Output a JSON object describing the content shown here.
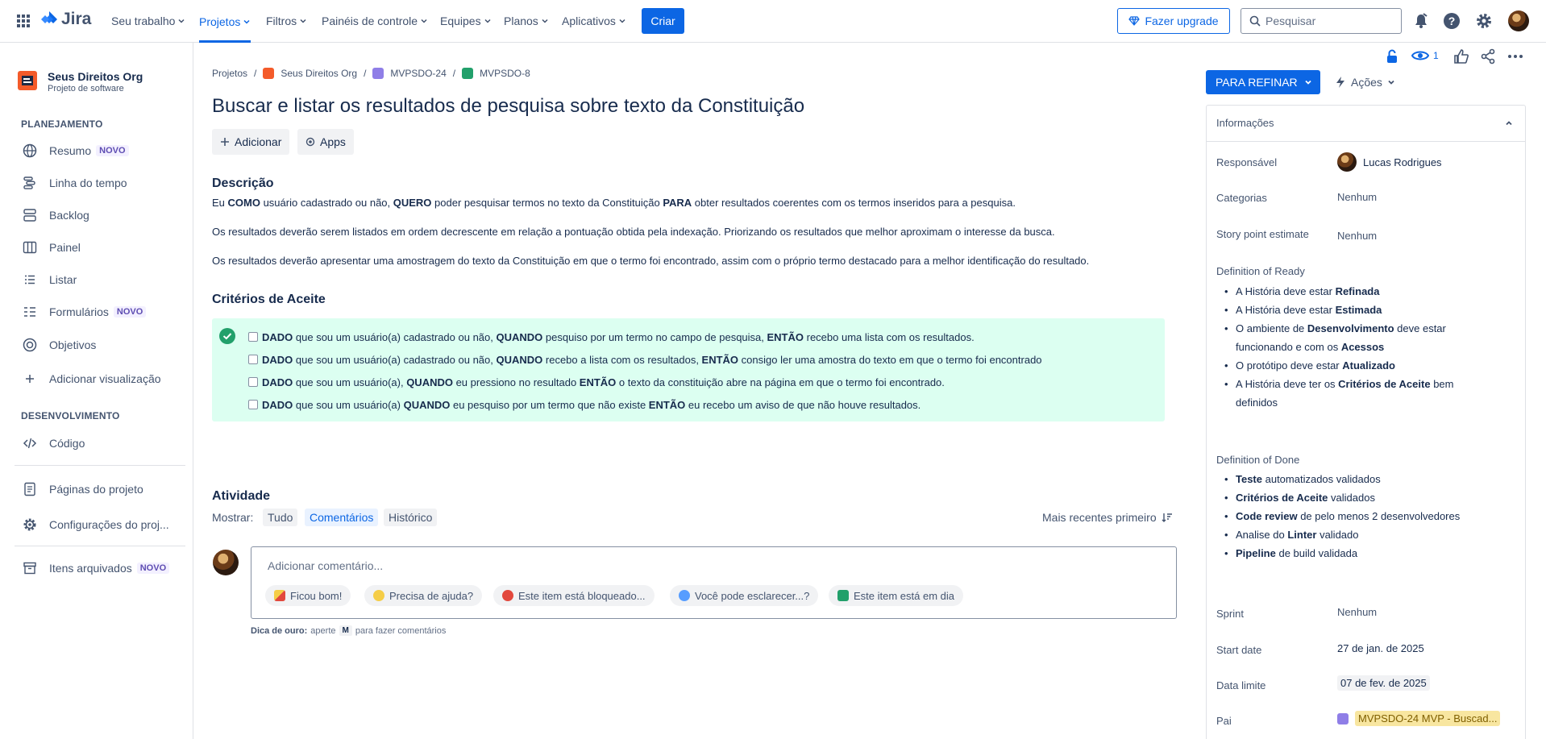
{
  "nav": {
    "logo": "Jira",
    "items": [
      "Seu trabalho",
      "Projetos",
      "Filtros",
      "Painéis de controle",
      "Equipes",
      "Planos",
      "Aplicativos"
    ],
    "create": "Criar",
    "upgrade": "Fazer upgrade",
    "search_placeholder": "Pesquisar"
  },
  "sidebar": {
    "project_name": "Seus Direitos Org",
    "project_type": "Projeto de software",
    "group_planning": "PLANEJAMENTO",
    "group_dev": "DESENVOLVIMENTO",
    "new_badge": "NOVO",
    "items": {
      "resumo": "Resumo",
      "linha": "Linha do tempo",
      "backlog": "Backlog",
      "painel": "Painel",
      "listar": "Listar",
      "formularios": "Formulários",
      "objetivos": "Objetivos",
      "adicionar": "Adicionar visualização",
      "codigo": "Código",
      "paginas": "Páginas do projeto",
      "config": "Configurações do proj...",
      "arquivados": "Itens arquivados"
    }
  },
  "issue": {
    "breadcrumbs": [
      "Projetos",
      "Seus Direitos Org",
      "MVPSDO-24",
      "MVPSDO-8"
    ],
    "title": "Buscar e listar os resultados de pesquisa sobre texto da Constituição",
    "add": "Adicionar",
    "apps": "Apps",
    "desc_heading": "Descrição",
    "desc": {
      "p1_a": "Eu ",
      "p1_b": "COMO",
      "p1_c": " usuário cadastrado ou não, ",
      "p1_d": "QUERO",
      "p1_e": " poder pesquisar termos no texto da Constituição ",
      "p1_f": "PARA",
      "p1_g": " obter resultados coerentes com os termos inseridos para a pesquisa.",
      "p2": "Os resultados deverão serem listados em ordem decrescente em relação a pontuação obtida pela indexação. Priorizando os resultados que melhor aproximam o interesse da busca.",
      "p3": "Os resultados deverão apresentar uma amostragem do texto da Constituição em que o termo foi encontrado, assim com o próprio termo destacado para a melhor identificação do resultado."
    },
    "ac_heading": "Critérios de Aceite",
    "ac": [
      {
        "k1": "DADO",
        "t1": " que sou um usuário(a) cadastrado ou não, ",
        "k2": "QUANDO",
        "t2": " pesquiso por um termo no campo de pesquisa, ",
        "k3": "ENTÃO",
        "t3": " recebo uma lista com os resultados."
      },
      {
        "k1": "DADO",
        "t1": " que sou um usuário(a) cadastrado ou não, ",
        "k2": "QUANDO",
        "t2": " recebo a lista com os resultados, ",
        "k3": "ENTÃO",
        "t3": " consigo ler uma amostra do texto em que o termo foi encontrado"
      },
      {
        "k1": "DADO",
        "t1": " que sou um usuário(a), ",
        "k2": "QUANDO",
        "t2": " eu pressiono no resultado ",
        "k3": "ENTÃO",
        "t3": " o texto da constituição abre na página em que o termo foi encontrado."
      },
      {
        "k1": "DADO",
        "t1": " que sou um usuário(a) ",
        "k2": "QUANDO",
        "t2": " eu pesquiso por um termo que não existe ",
        "k3": "ENTÃO",
        "t3": " eu recebo um aviso de que não houve resultados."
      }
    ],
    "activity": {
      "heading": "Atividade",
      "show": "Mostrar:",
      "tabs": [
        "Tudo",
        "Comentários",
        "Histórico"
      ],
      "sort": "Mais recentes primeiro",
      "comment_placeholder": "Adicionar comentário...",
      "chips": [
        "Ficou bom!",
        "Precisa de ajuda?",
        "Este item está bloqueado...",
        "Você pode esclarecer...?",
        "Este item está em dia"
      ],
      "tip_label": "Dica de ouro:",
      "tip_pre": "aperte",
      "tip_key": "M",
      "tip_post": "para fazer comentários"
    }
  },
  "toolbar": {
    "watch_count": "1"
  },
  "details": {
    "status": "PARA REFINAR",
    "actions": "Ações",
    "header": "Informações",
    "assignee_label": "Responsável",
    "assignee": "Lucas Rodrigues",
    "categories_label": "Categorias",
    "categories": "Nenhum",
    "story_label": "Story point estimate",
    "story": "Nenhum",
    "dor_label": "Definition of Ready",
    "dor": [
      {
        "pre": "A História deve estar ",
        "b": "Refinada",
        "post": ""
      },
      {
        "pre": "A História deve estar ",
        "b": "Estimada",
        "post": ""
      },
      {
        "pre": "O ambiente de ",
        "b": "Desenvolvimento",
        "post": " deve estar"
      },
      {
        "pre": "funcionando e com os ",
        "b": "Acessos",
        "post": ""
      },
      {
        "pre": "O protótipo deve estar ",
        "b": "Atualizado",
        "post": ""
      },
      {
        "pre": "A História deve ter os ",
        "b": "Critérios de Aceite",
        "post": " bem"
      },
      {
        "pre": "definidos",
        "b": "",
        "post": ""
      }
    ],
    "dod_label": "Definition of Done",
    "dod": [
      {
        "b": "Teste",
        "post": " automatizados validados",
        "pre": ""
      },
      {
        "b": "Critérios de Aceite",
        "post": " validados",
        "pre": ""
      },
      {
        "b": "Code review",
        "post": " de pelo menos 2 desenvolvedores",
        "pre": ""
      },
      {
        "pre": "Analise do ",
        "b": "Linter",
        "post": " validado"
      },
      {
        "b": "Pipeline",
        "post": " de build validada",
        "pre": ""
      }
    ],
    "sprint_label": "Sprint",
    "sprint": "Nenhum",
    "start_label": "Start date",
    "start": "27 de jan. de 2025",
    "due_label": "Data limite",
    "due": "07 de fev. de 2025",
    "parent_label": "Pai",
    "parent": "MVPSDO-24 MVP - Buscad..."
  },
  "colors": {
    "brand": "#0c66e4",
    "ac_bg": "#dcfff1",
    "success": "#22a06b"
  }
}
